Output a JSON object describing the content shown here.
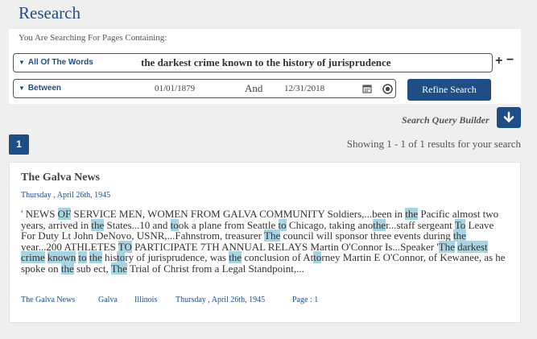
{
  "page": {
    "title": "Research"
  },
  "search": {
    "subtitle": "You Are Searching For Pages Containing:",
    "mode_label": "All Of The Words",
    "terms": "the darkest crime known to the history of jurisprudence",
    "date_mode_label": "Between",
    "date_from": "01/01/1879",
    "and_label": "And",
    "date_to": "12/31/2018",
    "refine_label": "Refine Search",
    "query_builder_label": "Search Query Builder"
  },
  "pagination": {
    "current_page": "1"
  },
  "results_summary": "Showing 1 - 1 of 1 results for your search",
  "result": {
    "title": "The Galva News",
    "date": "Thursday , April 26th, 1945",
    "snippet_segments": [
      {
        "t": "' NEWS "
      },
      {
        "t": "OF",
        "h": true
      },
      {
        "t": " SERVICE MEN, WOMEN FROM GALVA COMMUNITY Soldiers,...been in "
      },
      {
        "t": "the",
        "h": true
      },
      {
        "t": " Pacific almost two years, arrived in "
      },
      {
        "t": "the",
        "h": true
      },
      {
        "t": " States...10 and "
      },
      {
        "t": "to",
        "h": true
      },
      {
        "t": "ok a plane from Seattle "
      },
      {
        "t": "to",
        "h": true
      },
      {
        "t": " Chicago, taking ano"
      },
      {
        "t": "the",
        "h": true
      },
      {
        "t": "r...staff sergeant "
      },
      {
        "t": "To",
        "h": true
      },
      {
        "t": " Leave For Duty Lt John DeNovo, USNR,...Fahnstrom, treasurer "
      },
      {
        "t": "The",
        "h": true
      },
      {
        "t": " council will sponsor three events during "
      },
      {
        "t": "the",
        "h": true
      },
      {
        "t": " year...200 ATHLETES "
      },
      {
        "t": "TO",
        "h": true
      },
      {
        "t": " PARTICIPATE 7TH ANNUAL RELAYS Martin O'Connor Is...Speaker '"
      },
      {
        "t": "The",
        "h": true
      },
      {
        "t": " "
      },
      {
        "t": "darkest",
        "h": true
      },
      {
        "t": " "
      },
      {
        "t": "crime",
        "h": true
      },
      {
        "t": " "
      },
      {
        "t": "known",
        "h": true
      },
      {
        "t": " "
      },
      {
        "t": "to",
        "h": true
      },
      {
        "t": " "
      },
      {
        "t": "the",
        "h": true
      },
      {
        "t": " his"
      },
      {
        "t": "to",
        "h": true
      },
      {
        "t": "ry of jurisprudence, was "
      },
      {
        "t": "the",
        "h": true
      },
      {
        "t": " conclusion of At"
      },
      {
        "t": "to",
        "h": true
      },
      {
        "t": "rney Martin E O'Connor, of Kewanee, as he spoke on "
      },
      {
        "t": "the",
        "h": true
      },
      {
        "t": " sub ect, "
      },
      {
        "t": "The",
        "h": true
      },
      {
        "t": " Trial of Christ from a Legal Standpoint,..."
      }
    ],
    "meta": {
      "publication": "The Galva News",
      "city": "Galva",
      "state": "Illinois",
      "date": "Thursday , April 26th, 1945",
      "page": "Page : 1"
    }
  },
  "colors": {
    "accent": "#1f4e86",
    "highlight": "#a9d4e3",
    "background": "#efeff0"
  },
  "icons": [
    "caret-down-icon",
    "calendar-icon",
    "clear-icon",
    "plus-icon",
    "minus-icon",
    "arrow-down-icon"
  ]
}
